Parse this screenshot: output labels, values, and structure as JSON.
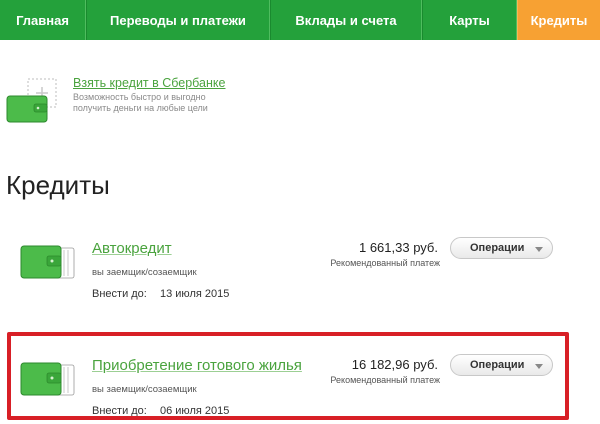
{
  "nav": {
    "items": [
      {
        "label": "Главная",
        "active": false
      },
      {
        "label": "Переводы и платежи",
        "active": false
      },
      {
        "label": "Вклады и счета",
        "active": false
      },
      {
        "label": "Карты",
        "active": false
      },
      {
        "label": "Кредиты",
        "active": true
      }
    ]
  },
  "promo": {
    "title": "Взять кредит в Сбербанке",
    "subtitle": "Возможность быстро и выгодно получить деньги на любые цели",
    "icon": "wallet-plus-icon"
  },
  "page_title": "Кредиты",
  "credits": [
    {
      "name": "Автокредит",
      "role": "вы заемщик/созаемщик",
      "due_label": "Внести до:",
      "due_date": "13 июля 2015",
      "amount": "1 661,33 руб.",
      "amount_label": "Рекомендованный платеж",
      "ops_label": "Операции",
      "icon": "wallet-icon"
    },
    {
      "name": "Приобретение готового жилья",
      "role": "вы заемщик/созаемщик",
      "due_label": "Внести до:",
      "due_date": "06 июля 2015",
      "amount": "16 182,96 руб.",
      "amount_label": "Рекомендованный платеж",
      "ops_label": "Операции",
      "icon": "wallet-icon",
      "highlighted": true
    }
  ],
  "colors": {
    "nav_green": "#24a13b",
    "nav_active": "#f7a133",
    "link_green": "#4aa33e",
    "highlight_red": "#d81f26"
  }
}
